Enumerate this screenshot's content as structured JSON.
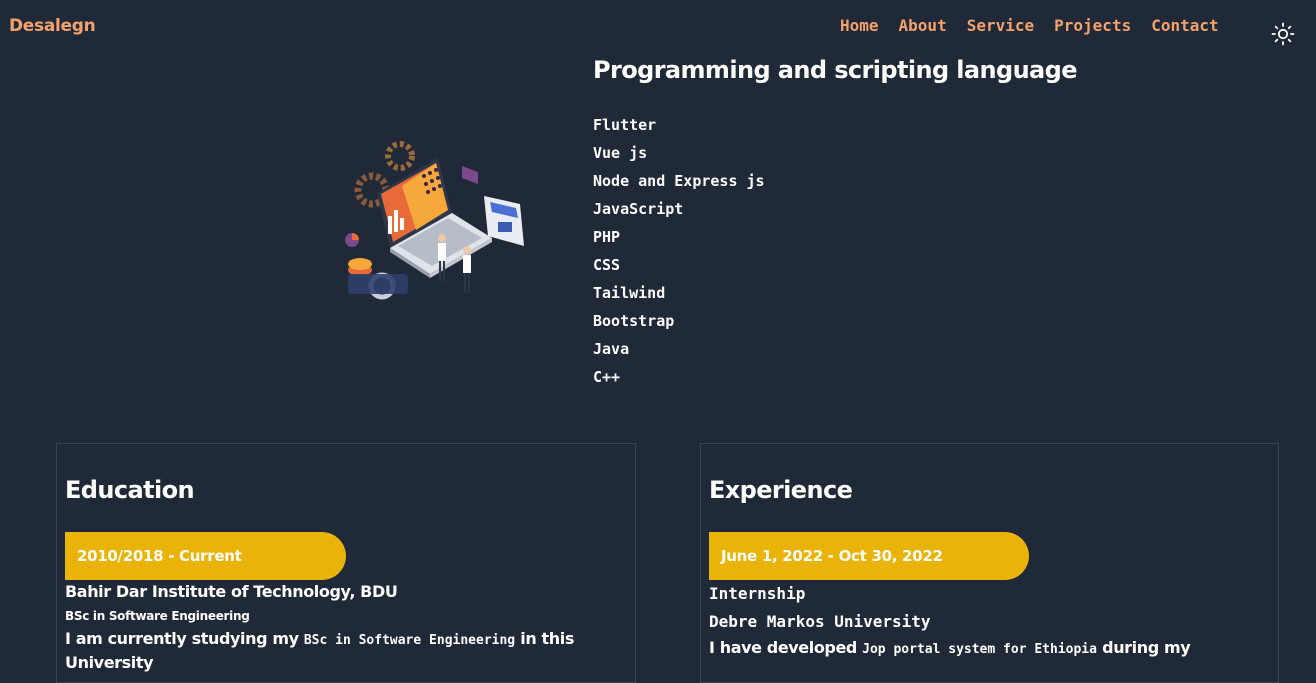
{
  "brand": "Desalegn",
  "nav": {
    "items": [
      "Home",
      "About",
      "Service",
      "Projects",
      "Contact"
    ]
  },
  "theme_toggle": {
    "icon": "sun-icon"
  },
  "skills": {
    "title": "Programming and scripting language",
    "items": [
      "Flutter",
      "Vue js",
      "Node and Express js",
      "JavaScript",
      "PHP",
      "CSS",
      "Tailwind",
      "Bootstrap",
      "Java",
      "C++"
    ]
  },
  "education": {
    "title": "Education",
    "period": "2010/2018 - Current",
    "school": "Bahir Dar Institute of Technology, BDU",
    "degree": "BSc in Software Engineering",
    "desc_prefix": "I am currently studying my ",
    "desc_highlight": "BSc in Software Engineering",
    "desc_suffix": " in this University"
  },
  "experience": {
    "title": "Experience",
    "period": "June 1, 2022 - Oct 30, 2022",
    "role": "Internship",
    "organization": "Debre Markos University",
    "desc_prefix": "I have developed ",
    "desc_highlight": "Jop portal system for Ethiopia",
    "desc_suffix": " during my"
  },
  "colors": {
    "background": "#1f2937",
    "accent": "#f4a16b",
    "pill": "#eab308"
  }
}
